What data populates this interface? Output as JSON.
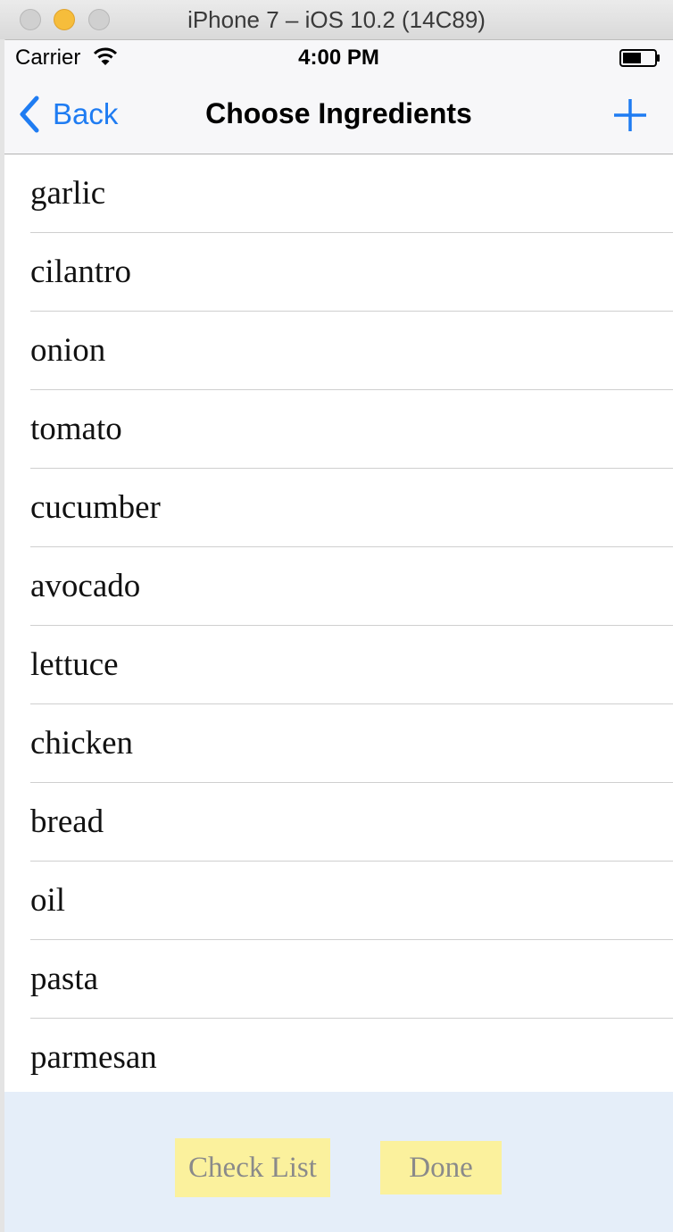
{
  "window": {
    "title": "iPhone 7 – iOS 10.2 (14C89)"
  },
  "status_bar": {
    "carrier": "Carrier",
    "time": "4:00 PM"
  },
  "nav_bar": {
    "back_label": "Back",
    "title": "Choose Ingredients",
    "add_icon": "plus-icon"
  },
  "ingredients": [
    "garlic",
    "cilantro",
    "onion",
    "tomato",
    "cucumber",
    "avocado",
    "lettuce",
    "chicken",
    "bread",
    "oil",
    "pasta",
    "parmesan"
  ],
  "toolbar": {
    "check_list_label": "Check List",
    "done_label": "Done"
  },
  "colors": {
    "tint": "#1f7cf2",
    "toolbar_bg": "#e5eef9",
    "button_bg": "#fbf19d",
    "button_text": "#8a8a8a"
  }
}
